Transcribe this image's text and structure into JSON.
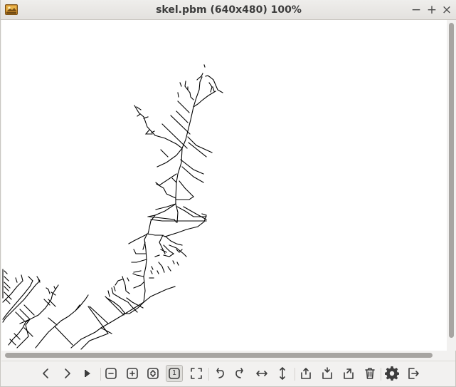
{
  "window": {
    "title": "skel.pbm (640x480) 100%",
    "controls": {
      "minimize": "−",
      "maximize": "+",
      "close": "×"
    }
  },
  "image": {
    "background": "#ffffff",
    "stroke_color": "#000000"
  },
  "toolbar": {
    "buttons": [
      "chevron-left-icon",
      "chevron-right-icon",
      "play-icon",
      "zoom-out-icon",
      "zoom-in-icon",
      "zoom-fit-icon",
      "zoom-original-icon",
      "fullscreen-icon",
      "rotate-ccw-icon",
      "rotate-cw-icon",
      "flip-horizontal-icon",
      "flip-vertical-icon",
      "save-icon",
      "save-as-icon",
      "save-copy-icon",
      "trash-icon",
      "gear-icon",
      "exit-icon"
    ],
    "zoom_original_label": "1",
    "active_button": "zoom-original"
  }
}
